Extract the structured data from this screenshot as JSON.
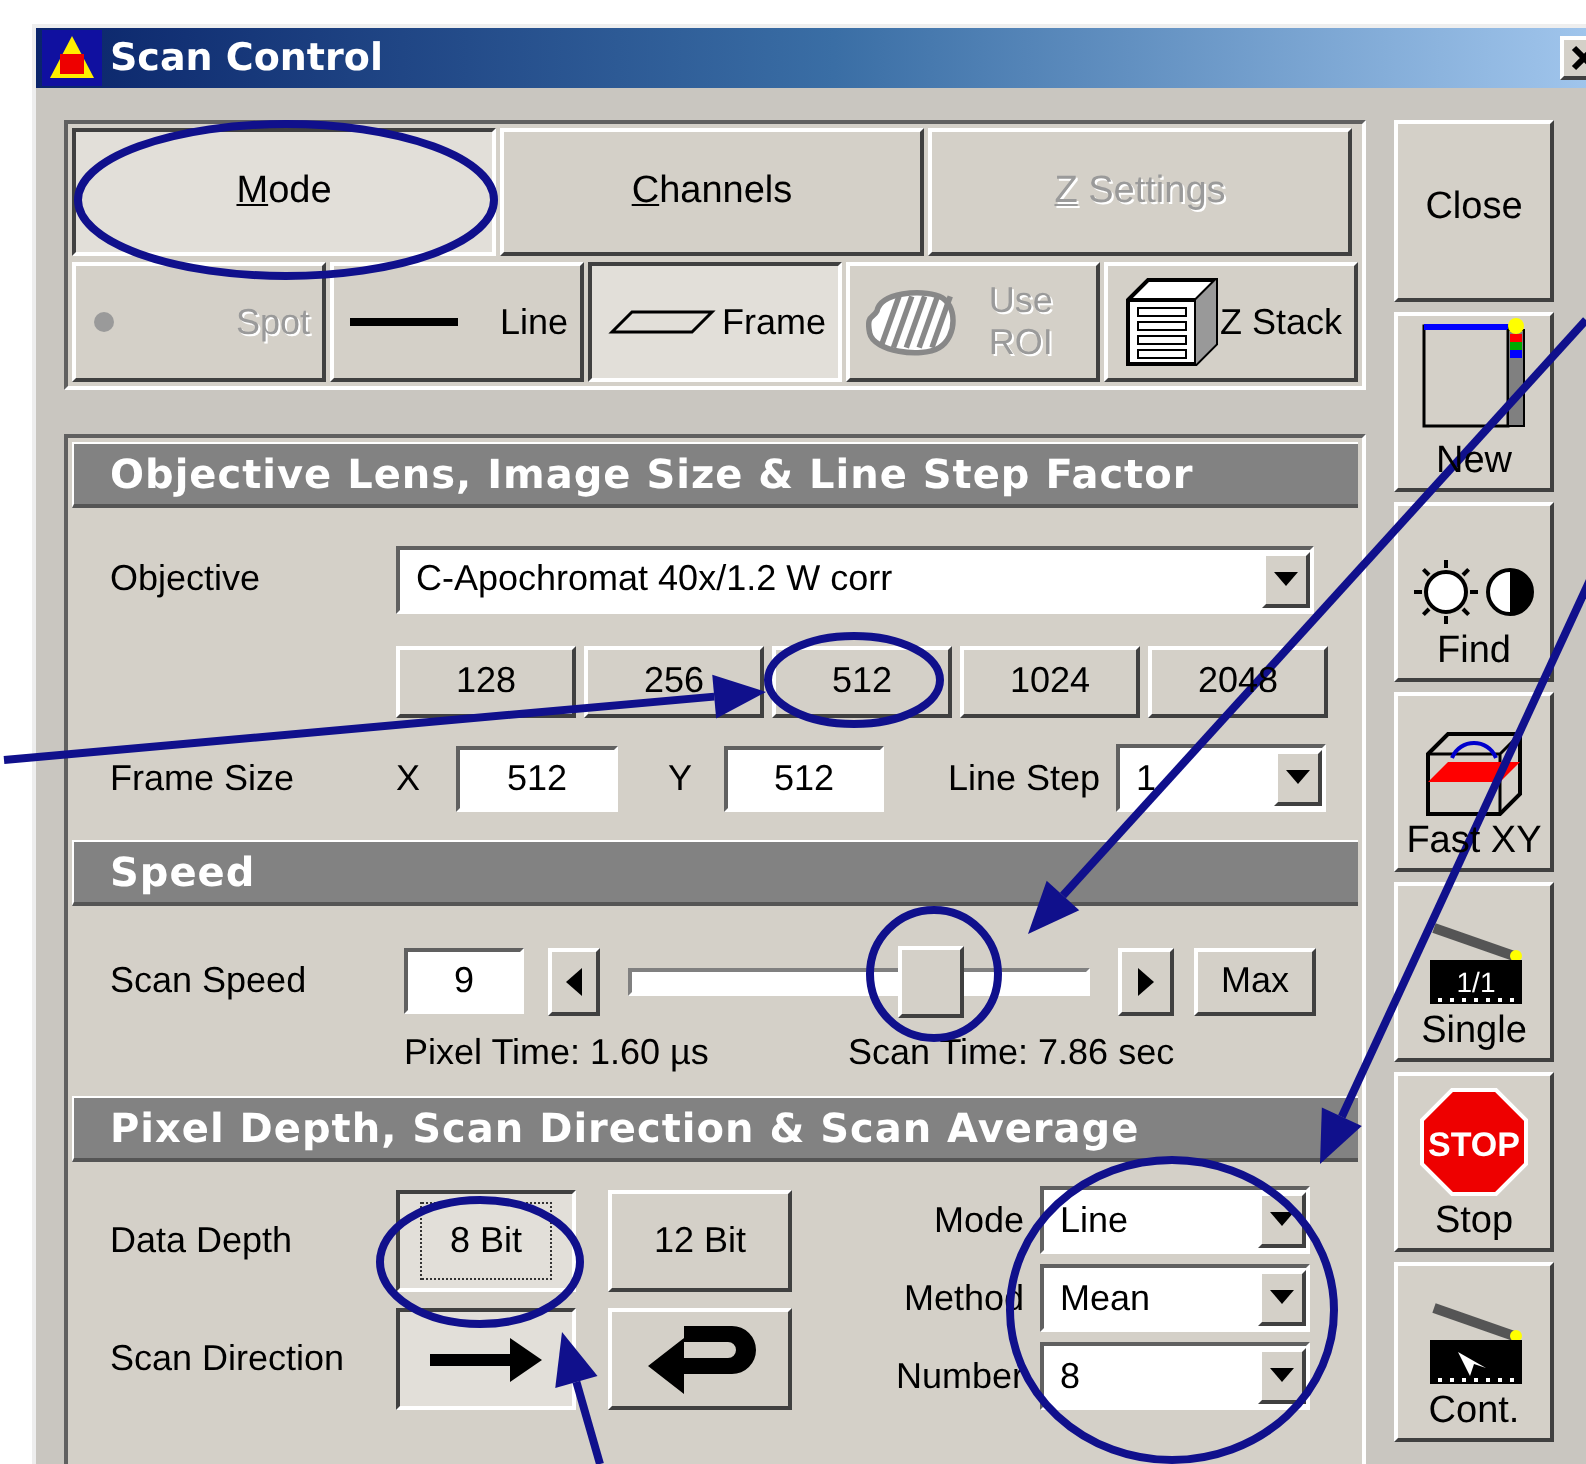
{
  "window": {
    "title": "Scan Control"
  },
  "tabs": [
    {
      "label": "Mode",
      "selected": true,
      "disabled": false,
      "mnemonic_underlined": true
    },
    {
      "label": "Channels",
      "selected": false,
      "disabled": false,
      "mnemonic_underlined": true
    },
    {
      "label": "Z Settings",
      "selected": false,
      "disabled": true,
      "mnemonic_underlined": true
    }
  ],
  "scan_modes": [
    {
      "kind": "spot",
      "label": "Spot",
      "selected": false,
      "disabled": true
    },
    {
      "kind": "line",
      "label": "Line",
      "selected": false,
      "disabled": false
    },
    {
      "kind": "frame",
      "label": "Frame",
      "selected": true,
      "disabled": false
    },
    {
      "kind": "roi",
      "label": "Use ROI",
      "selected": false,
      "disabled": true
    },
    {
      "kind": "zstack",
      "label": "Z Stack",
      "selected": false,
      "disabled": false
    }
  ],
  "objective_section": {
    "title": "Objective Lens, Image Size & Line Step Factor",
    "objective_label": "Objective",
    "objective": "C-Apochromat 40x/1.2 W corr",
    "sizes": [
      "128",
      "256",
      "512",
      "1024",
      "2048"
    ],
    "frame_size_label": "Frame Size",
    "x_label": "X",
    "x_value": "512",
    "y_label": "Y",
    "y_value": "512",
    "line_step_label": "Line Step",
    "line_step": "1"
  },
  "speed_section": {
    "title": "Speed",
    "scan_speed_label": "Scan Speed",
    "scan_speed": "9",
    "level": 0.68,
    "max_button": "Max",
    "pixel_time": "Pixel Time:  1.60 µs",
    "scan_time": "Scan Time:  7.86 sec"
  },
  "depth_section": {
    "title": "Pixel Depth, Scan Direction & Scan Average",
    "data_depth_label": "Data Depth",
    "depths": [
      {
        "label": "8 Bit",
        "selected": true
      },
      {
        "label": "12 Bit",
        "selected": false
      }
    ],
    "scan_direction_label": "Scan Direction",
    "directions": [
      {
        "kind": "forward",
        "selected": true
      },
      {
        "kind": "bidirectional",
        "selected": false
      }
    ],
    "averages": [
      {
        "label": "Mode",
        "value": "Line"
      },
      {
        "label": "Method",
        "value": "Mean"
      },
      {
        "label": "Number",
        "value": "8"
      }
    ]
  },
  "side_buttons": [
    {
      "kind": "close",
      "label": "Close"
    },
    {
      "kind": "new",
      "label": "New"
    },
    {
      "kind": "find",
      "label": "Find"
    },
    {
      "kind": "fastxy",
      "label": "Fast XY"
    },
    {
      "kind": "single",
      "label": "Single",
      "badge": "1/1"
    },
    {
      "kind": "stop",
      "label": "Stop",
      "badge": "STOP"
    },
    {
      "kind": "cont",
      "label": "Cont."
    }
  ]
}
